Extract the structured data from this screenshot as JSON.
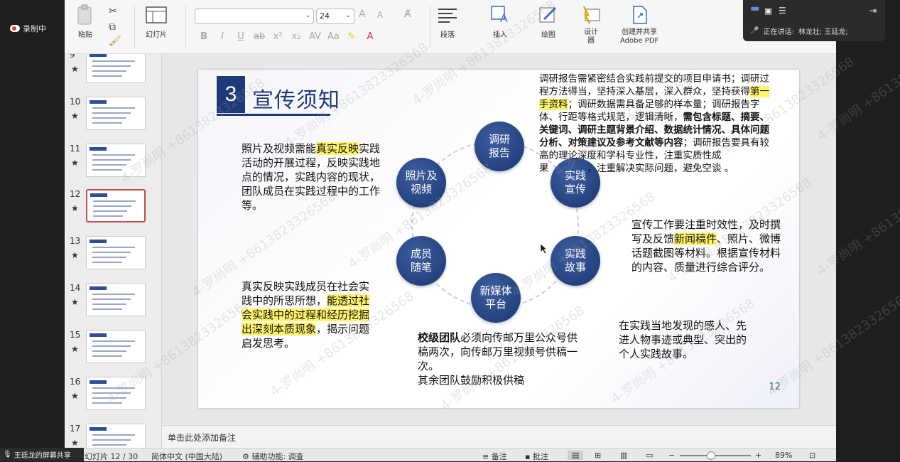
{
  "meeting": {
    "recording_label": "录制中",
    "speaking_label": "正在讲话:",
    "speaking_names": "林龙壮; 王廷龙;",
    "share_label": "王廷龙的屏幕共享"
  },
  "ribbon": {
    "paste": "粘贴",
    "slides": "幻灯片",
    "font_size": "24",
    "paragraph": "段落",
    "insert": "插入",
    "draw": "绘图",
    "design": "设计\n器",
    "create_share": "创建并共享\nAdobe PDF"
  },
  "thumbnails": [
    {
      "num": "9"
    },
    {
      "num": "10"
    },
    {
      "num": "11"
    },
    {
      "num": "12"
    },
    {
      "num": "13"
    },
    {
      "num": "14"
    },
    {
      "num": "15"
    },
    {
      "num": "16"
    },
    {
      "num": "17"
    }
  ],
  "slide": {
    "badge": "3",
    "title": "宣传须知",
    "circles": {
      "report": "调研\n报告",
      "photo": "照片及\n视频",
      "practice_promo": "实践\n宣传",
      "member_notes": "成员\n随笔",
      "practice_story": "实践\n故事",
      "new_media": "新媒体\n平台"
    },
    "texts": {
      "report_desc_1": "调研报告需紧密结合实践前提交的项目申请书；调研过程方法得当，坚持深入基层，深入群众，坚持获得",
      "report_desc_hl": "第一手资料",
      "report_desc_2": "；调研数据需具备足够的样本量；调研报告字体、行距等格式规范，逻辑清晰，",
      "report_desc_bold": "需包含标题、摘要、关键词、调研主题背景介绍、数据统计情况、具体问题分析、对策建议及参考文献等内容",
      "report_desc_3": "；调研报告要具有较高的理论深度和学科专业性，注重实质性成 果　　　　，注重解决实际问题，避免空谈 。",
      "photo_desc_1": "照片及视频需能",
      "photo_desc_hl": "真实反映",
      "photo_desc_2": "实践活动的开展过程，反映实践地点的情况，实践内容的现状，团队成员在实践过程中的工作等。",
      "promo_desc_1": "宣传工作要注重时效性，及时撰写及反馈",
      "promo_desc_hl": "新闻稿件",
      "promo_desc_2": "、照片、微博话题截图等材料。根据宣传材料的内容、质量进行综合评分。",
      "notes_desc_1": "真实反映实践成员在社会实践中的所思所想，",
      "notes_desc_hl": "能透过社会实践中的过程和经历挖掘出深刻本质现象",
      "notes_desc_2": "，揭示问题启发思考。",
      "story_desc": "在实践当地发现的感人、先进人物事迹或典型、突出的个人实践故事。",
      "media_desc_bold": "校级团队",
      "media_desc_1": "必须向传邮万里公众号供稿两次，向传邮万里视频号供稿一次。",
      "media_desc_2": "其余团队鼓励积极供稿"
    },
    "page_number": "12"
  },
  "notes_placeholder": "单击此处添加备注",
  "status": {
    "slide_pos": "幻灯片 12 / 30",
    "language": "简体中文 (中国大陆)",
    "accessibility": "辅助功能: 调查",
    "notes_btn": "备注",
    "comments_btn": "批注",
    "zoom": "89%"
  },
  "watermark_text": "4-罗尚明 +8613823326568"
}
